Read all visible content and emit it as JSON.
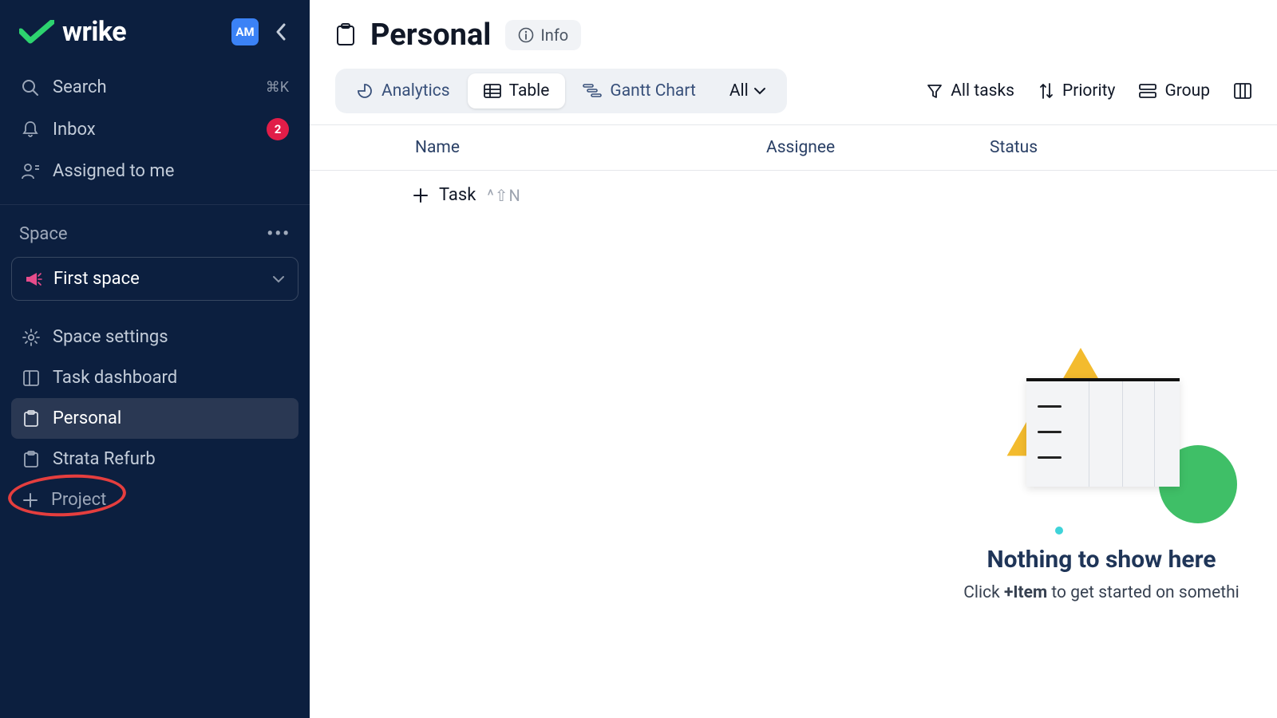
{
  "brand": {
    "name": "wrike"
  },
  "user": {
    "initials": "AM"
  },
  "sidebar": {
    "search_label": "Search",
    "search_shortcut": "⌘K",
    "inbox_label": "Inbox",
    "inbox_badge": "2",
    "assigned_label": "Assigned to me",
    "space_heading": "Space",
    "selected_space": "First space",
    "items": [
      {
        "label": "Space settings"
      },
      {
        "label": "Task dashboard"
      },
      {
        "label": "Personal"
      },
      {
        "label": "Strata Refurb"
      }
    ],
    "add_project_label": "Project"
  },
  "header": {
    "title": "Personal",
    "info_label": "Info"
  },
  "views": {
    "analytics": "Analytics",
    "table": "Table",
    "gantt": "Gantt Chart",
    "all": "All"
  },
  "toolbar": {
    "all_tasks": "All tasks",
    "priority": "Priority",
    "group": "Group"
  },
  "table": {
    "col_name": "Name",
    "col_assignee": "Assignee",
    "col_status": "Status",
    "add_task": "Task",
    "add_task_shortcut": "^⇧N"
  },
  "empty": {
    "title": "Nothing to show here",
    "sub_pre": "Click ",
    "sub_bold": "+Item",
    "sub_post": " to get started on somethi"
  }
}
